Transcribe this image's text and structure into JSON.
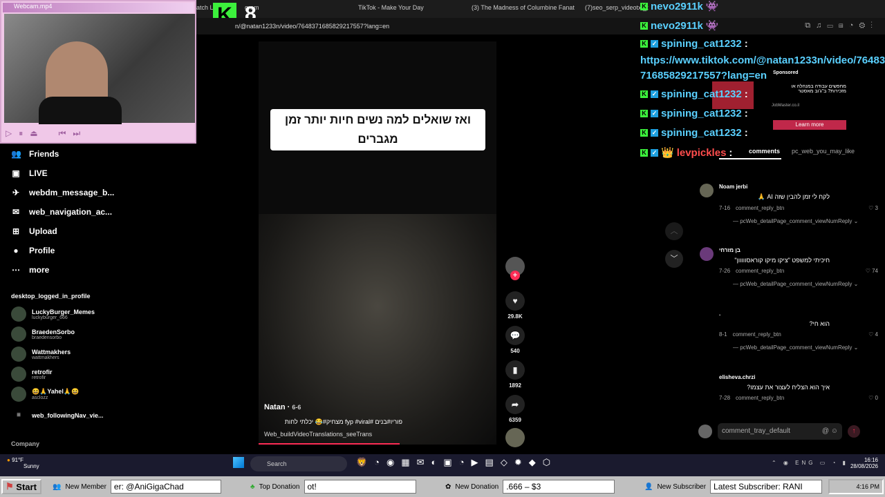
{
  "webcam": {
    "title": "Webcam.mp4"
  },
  "browser": {
    "tabs": [
      "atch Li",
      "gram",
      "TikTok - Make Your Day",
      "(3) The Madness of Columbine Fanat",
      "(7)seo_serp_videotxt_t"
    ],
    "url": "n/@natan1233n/video/7648371685829217557?lang=en",
    "kick_num": "8"
  },
  "chat": {
    "lines": [
      {
        "user": "nevo2911k",
        "text": "",
        "color": "#5ad0ff"
      },
      {
        "user": "nevo2911k",
        "text": "",
        "color": "#5ad0ff"
      },
      {
        "user": "spining_cat1232",
        "text": ":",
        "color": "#5ad0ff"
      },
      {
        "user": "",
        "text": "https://www.tiktok.com/@natan1233n/video/76483",
        "color": "#5ad0ff"
      },
      {
        "user": "",
        "text": "71685829217557?lang=en",
        "color": "#5ad0ff"
      },
      {
        "user": "spining_cat1232",
        "text": ":",
        "color": "#5ad0ff"
      },
      {
        "user": "spining_cat1232",
        "text": ":",
        "color": "#5ad0ff"
      },
      {
        "user": "spining_cat1232",
        "text": ":",
        "color": "#5ad0ff"
      },
      {
        "user": "levpickles",
        "text": ":",
        "color": "#ff4d4d"
      }
    ]
  },
  "ad": {
    "sponsored": "Sponsored",
    "text": "מחפשים עבודה במנהלה או מזכירות? ב\"ג'וב מאסטר",
    "site": "JobMaster.co.il",
    "cta": "Learn more"
  },
  "sidebar": {
    "items": [
      {
        "icon": "friends-icon",
        "label": "Friends"
      },
      {
        "icon": "live-icon",
        "label": "LIVE"
      },
      {
        "icon": "message-icon",
        "label": "webdm_message_b..."
      },
      {
        "icon": "navigation-icon",
        "label": "web_navigation_ac..."
      },
      {
        "icon": "upload-icon",
        "label": "Upload"
      },
      {
        "icon": "profile-icon",
        "label": "Profile"
      },
      {
        "icon": "more-icon",
        "label": "more"
      }
    ],
    "section": "desktop_logged_in_profile",
    "following": [
      {
        "name": "LuckyBurger_Memes",
        "handle": "luckyburger_666"
      },
      {
        "name": "BraedenSorbo",
        "handle": "braedensorbo"
      },
      {
        "name": "Wattmakhers",
        "handle": "wattmakhers"
      },
      {
        "name": "retrofir",
        "handle": "retrofir"
      },
      {
        "name": "😆🙏Yahel🙏😆",
        "handle": "asclozz"
      }
    ],
    "following_more": "web_followingNav_vie...",
    "company": "Company"
  },
  "video": {
    "caption": "ואז שואלים למה נשים חיות יותר זמן מגברים",
    "author": "Natan",
    "date": "6-6",
    "desc": "פוריו#בנים #fyp #viral מצחיק#😂 יכלתי לחות",
    "translate": "Web_buildVideoTranslations_seeTrans",
    "likes": "29.8K",
    "comments": "540",
    "saves": "1892",
    "shares": "6359"
  },
  "comments": {
    "tabs": [
      "comments",
      "pc_web_you_may_like"
    ],
    "items": [
      {
        "user": "Noam jerbi",
        "text": "לקח לי זמן להבין שזה AI 🙏",
        "date": "7-16",
        "reply": "comment_reply_btn",
        "likes": "3",
        "view": "pcWeb_detailPage_comment_viewNumReply"
      },
      {
        "user": "בן מזרחי",
        "text": "חיכיתי למשפט \"ציקו מיקו קוראסווווון\"",
        "date": "7-26",
        "reply": "comment_reply_btn",
        "likes": "74",
        "view": "pcWeb_detailPage_comment_viewNumReply"
      },
      {
        "user": ".",
        "text": "הוא חי?",
        "date": "8-1",
        "reply": "comment_reply_btn",
        "likes": "4",
        "view": "pcWeb_detailPage_comment_viewNumReply"
      },
      {
        "user": "elisheva.chrzi",
        "text": "איך הוא הצליח לעצור את עצמו?",
        "date": "7-28",
        "reply": "comment_reply_btn",
        "likes": "0",
        "view": ""
      }
    ],
    "input_placeholder": "comment_tray_default"
  },
  "taskbar": {
    "weather_temp": "91°F",
    "weather": "Sunny",
    "search": "Search",
    "lang": "ENG",
    "time": "16:16",
    "date": "28/08/2026"
  },
  "bottombar": {
    "start": "Start",
    "new_member": "New Member",
    "member_val": "er: @AniGigaChad",
    "top_donation": "Top Donation",
    "top_val": "ot!",
    "new_donation": "New Donation",
    "don_val": ".666 – $3",
    "new_sub": "New Subscriber",
    "sub_val": "Latest Subscriber: RANI",
    "clock": "4:16 PM"
  }
}
